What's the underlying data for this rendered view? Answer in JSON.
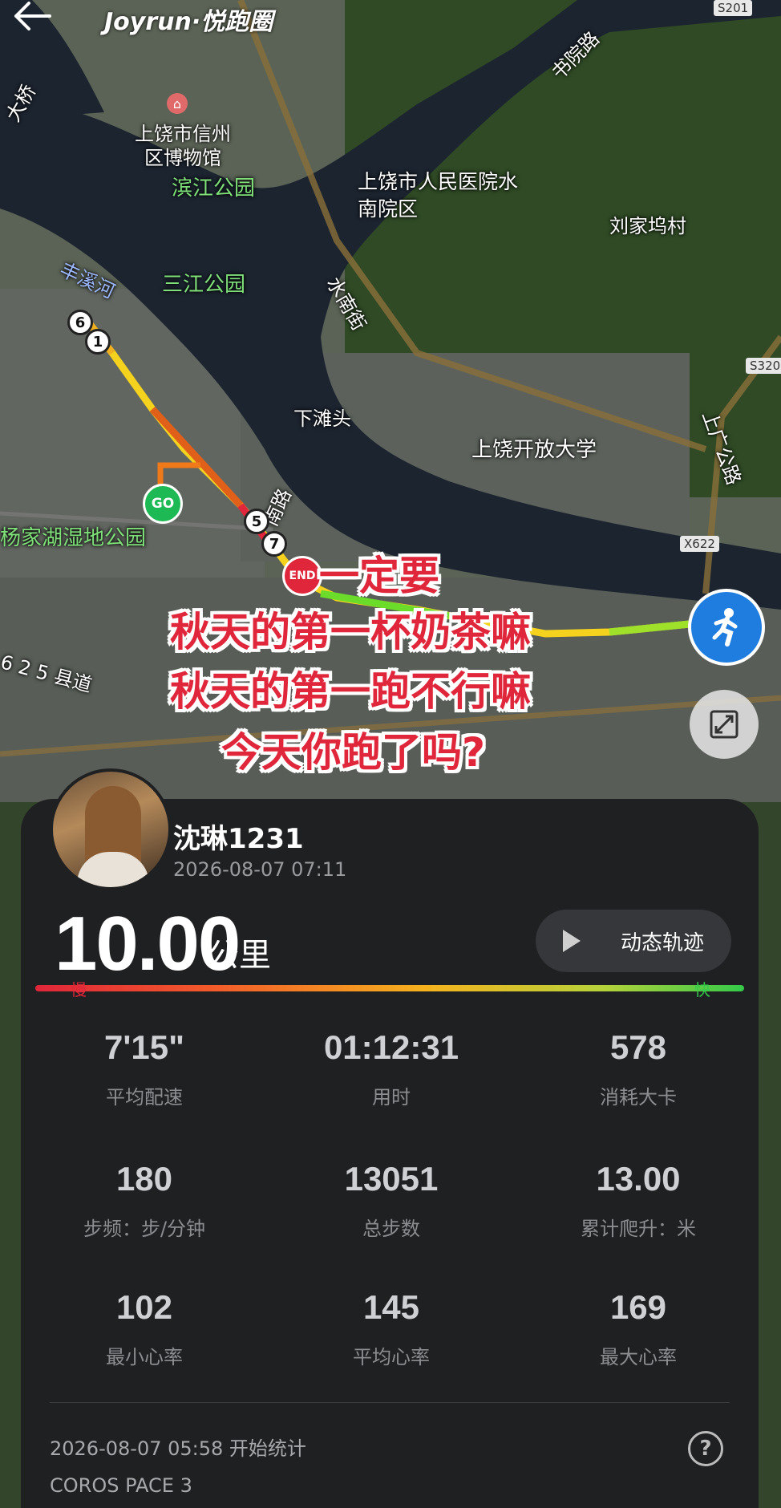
{
  "app": {
    "title": "Joyrun·悦跑圈"
  },
  "map": {
    "labels": [
      {
        "text": "上饶市信州区博物馆",
        "style": "white"
      },
      {
        "text": "滨江公园",
        "style": "green"
      },
      {
        "text": "上饶市人民医院水南院区",
        "style": "white"
      },
      {
        "text": "书院路",
        "style": "white"
      },
      {
        "text": "刘家坞村",
        "style": "white"
      },
      {
        "text": "丰溪河",
        "style": "blue"
      },
      {
        "text": "三江公园",
        "style": "green"
      },
      {
        "text": "水南街",
        "style": "white"
      },
      {
        "text": "下滩头",
        "style": "white"
      },
      {
        "text": "上饶开放大学",
        "style": "white"
      },
      {
        "text": "上广公路",
        "style": "white"
      },
      {
        "text": "杨家湖湿地公园",
        "style": "green"
      },
      {
        "text": "6 2 5 县道",
        "style": "white"
      },
      {
        "text": "大桥",
        "style": "white"
      },
      {
        "text": "南路",
        "style": "white"
      }
    ],
    "road_tags": [
      "S201",
      "S320",
      "X622"
    ],
    "km_markers": [
      "6",
      "1",
      "5",
      "7"
    ],
    "go_label": "GO",
    "end_label": "END"
  },
  "caption": {
    "line1": "一定要",
    "line2": "秋天的第一杯奶茶嘛",
    "line3": "秋天的第一跑不行嘛",
    "line4": "今天你跑了吗?"
  },
  "user": {
    "name": "沈琳1231",
    "date": "2026-08-07 07:11"
  },
  "run": {
    "distance": "10.00",
    "distance_unit": "公里",
    "replay_label": "动态轨迹",
    "pace_slow": "慢",
    "pace_fast": "快"
  },
  "stats": [
    {
      "value": "7'15\"",
      "label": "平均配速"
    },
    {
      "value": "01:12:31",
      "label": "用时"
    },
    {
      "value": "578",
      "label": "消耗大卡"
    },
    {
      "value": "180",
      "label": "步频：步/分钟"
    },
    {
      "value": "13051",
      "label": "总步数"
    },
    {
      "value": "13.00",
      "label": "累计爬升：米"
    },
    {
      "value": "102",
      "label": "最小心率"
    },
    {
      "value": "145",
      "label": "平均心率"
    },
    {
      "value": "169",
      "label": "最大心率"
    }
  ],
  "footer": {
    "start_text": "2026-08-07 05:58 开始统计",
    "device": "COROS PACE 3",
    "help_glyph": "?"
  }
}
